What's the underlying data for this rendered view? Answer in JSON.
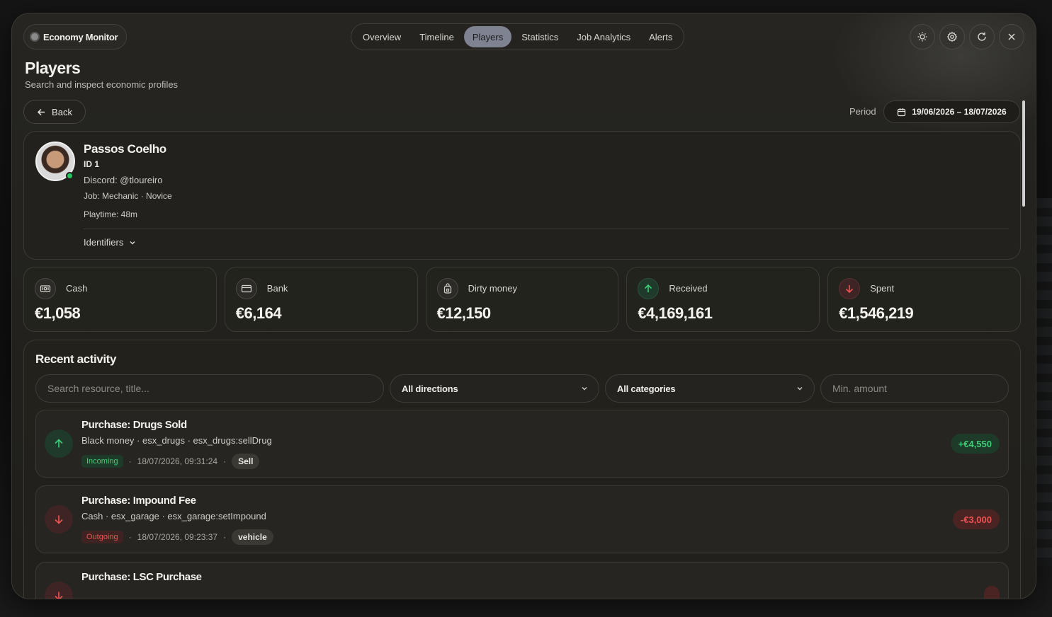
{
  "app": {
    "title": "Economy Monitor"
  },
  "nav": {
    "items": [
      {
        "label": "Overview",
        "active": false
      },
      {
        "label": "Timeline",
        "active": false
      },
      {
        "label": "Players",
        "active": true
      },
      {
        "label": "Statistics",
        "active": false
      },
      {
        "label": "Job Analytics",
        "active": false
      },
      {
        "label": "Alerts",
        "active": false
      }
    ]
  },
  "toolbar_icons": [
    "sun-icon",
    "gear-icon",
    "refresh-icon",
    "close-icon"
  ],
  "page": {
    "title": "Players",
    "subtitle": "Search and inspect economic profiles"
  },
  "back_label": "Back",
  "period": {
    "label": "Period",
    "value": "19/06/2026 – 18/07/2026"
  },
  "player": {
    "name": "Passos Coelho",
    "id": "ID 1",
    "discord": "Discord: @tloureiro",
    "job": "Job: Mechanic · Novice",
    "playtime": "Playtime: 48m",
    "identifiers_label": "Identifiers",
    "status_color": "#22c55e"
  },
  "stats": [
    {
      "label": "Cash",
      "value": "€1,058",
      "icon": "cash-icon"
    },
    {
      "label": "Bank",
      "value": "€6,164",
      "icon": "card-icon"
    },
    {
      "label": "Dirty money",
      "value": "€12,150",
      "icon": "bag-icon"
    },
    {
      "label": "Received",
      "value": "€4,169,161",
      "icon": "arrow-up-icon"
    },
    {
      "label": "Spent",
      "value": "€1,546,219",
      "icon": "arrow-down-icon"
    }
  ],
  "activity": {
    "title": "Recent activity",
    "filters": {
      "search_placeholder": "Search resource, title...",
      "direction": "All directions",
      "category": "All categories",
      "min_amount_placeholder": "Min. amount"
    },
    "transactions": [
      {
        "title": "Purchase: Drugs Sold",
        "subtitle": "Black money · esx_drugs · esx_drugs:sellDrug",
        "direction": "Incoming",
        "time": "18/07/2026, 09:31:24",
        "category": "Sell",
        "amount": "+€4,550"
      },
      {
        "title": "Purchase: Impound Fee",
        "subtitle": "Cash · esx_garage · esx_garage:setImpound",
        "direction": "Outgoing",
        "time": "18/07/2026, 09:23:37",
        "category": "vehicle",
        "amount": "-€3,000"
      },
      {
        "title": "Purchase: LSC Purchase"
      }
    ]
  },
  "colors": {
    "accent": "#7e8291",
    "incoming": "#3ecf78",
    "outgoing": "#ef5350",
    "panel": "#22211d"
  }
}
